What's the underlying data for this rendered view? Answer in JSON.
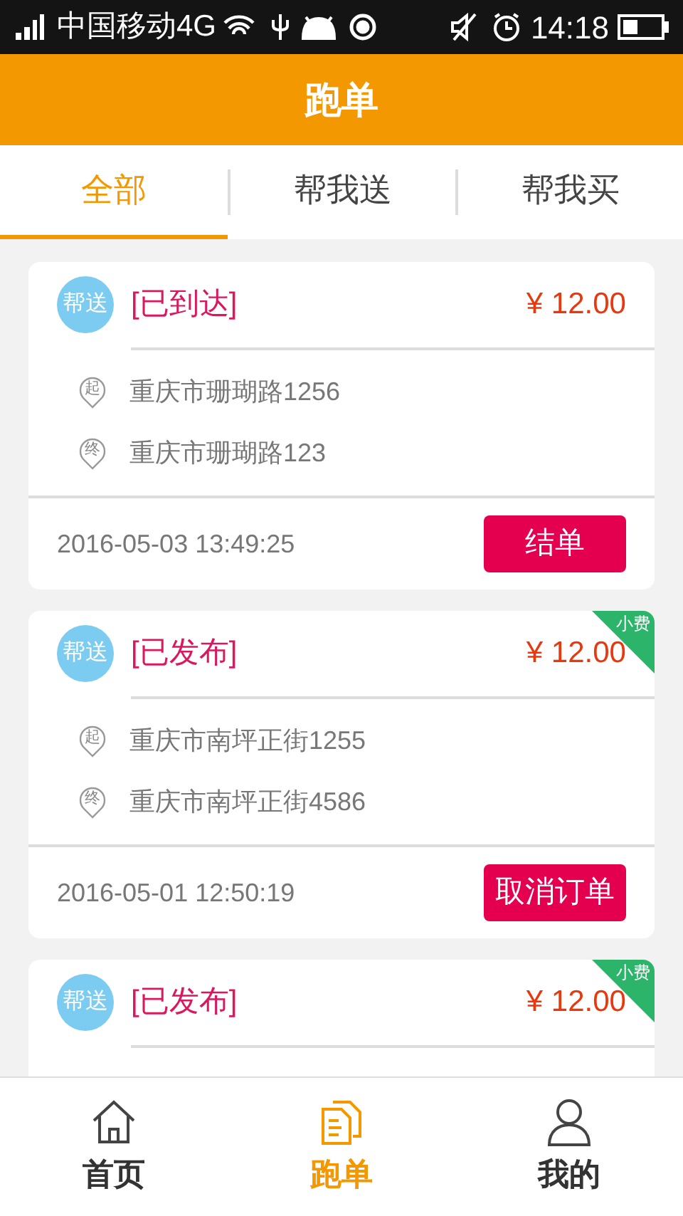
{
  "status_bar": {
    "carrier": "中国移动4G",
    "time": "14:18"
  },
  "header": {
    "title": "跑单"
  },
  "tabs": [
    {
      "label": "全部",
      "selected": true
    },
    {
      "label": "帮我送",
      "selected": false
    },
    {
      "label": "帮我买",
      "selected": false
    }
  ],
  "orders": [
    {
      "type": "帮送",
      "status": "[已到达]",
      "price": "¥ 12.00",
      "from_mark": "起",
      "from": "重庆市珊瑚路1256",
      "to_mark": "终",
      "to": "重庆市珊瑚路123",
      "time": "2016-05-03 13:49:25",
      "action": "结单"
    },
    {
      "type": "帮送",
      "status": "[已发布]",
      "price": "¥ 12.00",
      "tip": "小费",
      "from_mark": "起",
      "from": "重庆市南坪正街1255",
      "to_mark": "终",
      "to": "重庆市南坪正街4586",
      "time": "2016-05-01 12:50:19",
      "action": "取消订单"
    },
    {
      "type": "帮送",
      "status": "[已发布]",
      "price": "¥ 12.00",
      "tip": "小费"
    }
  ],
  "bottom_nav": [
    {
      "kind": "home",
      "label": "首页",
      "selected": false
    },
    {
      "kind": "orders",
      "label": "跑单",
      "selected": true
    },
    {
      "kind": "profile",
      "label": "我的",
      "selected": false
    }
  ]
}
